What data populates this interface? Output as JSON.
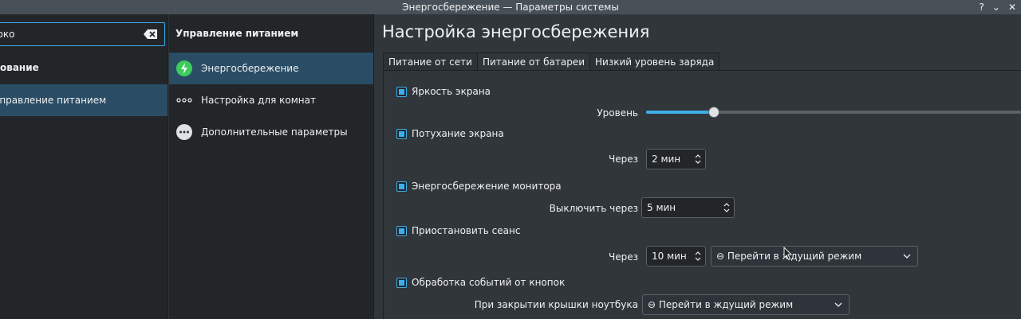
{
  "window": {
    "title": "Энергосбережение — Параметры системы",
    "help_glyph": "?",
    "minimize_glyph": "⌄",
    "close_glyph": "✕"
  },
  "sidebar": {
    "search_value": "ярко",
    "category_header": "ование",
    "category_item": "Управление питанием"
  },
  "subnav": {
    "header": "Управление питанием",
    "items": [
      {
        "label": "Энергосбережение",
        "icon": "power-saving-icon"
      },
      {
        "label": "Настройка для комнат",
        "icon": "activities-icon"
      },
      {
        "label": "Дополнительные параметры",
        "icon": "more-options-icon"
      }
    ]
  },
  "main": {
    "title": "Настройка энергосбережения",
    "tabs": [
      "Питание от сети",
      "Питание от батареи",
      "Низкий уровень заряда"
    ],
    "active_tab": 1,
    "brightness": {
      "label": "Яркость экрана",
      "checked": true,
      "level_label": "Уровень",
      "level_fraction": 0.18
    },
    "dim": {
      "label": "Потухание экрана",
      "checked": true,
      "after_label": "Через",
      "value": "2 мин"
    },
    "dpms": {
      "label": "Энергосбережение монитора",
      "checked": true,
      "after_label": "Выключить через",
      "value": "5 мин"
    },
    "suspend": {
      "label": "Приостановить сеанс",
      "checked": true,
      "after_label": "Через",
      "value": "10 мин",
      "action": "⊖ Перейти в ждущий режим"
    },
    "buttons": {
      "label": "Обработка событий от кнопок",
      "checked": true,
      "lid_label": "При закрытии крышки ноутбука",
      "lid_action": "⊖ Перейти в ждущий режим"
    }
  },
  "colors": {
    "accent": "#3daee9",
    "selection": "#2a4d65",
    "panel_dark": "#232629",
    "panel": "#31363b",
    "green_icon": "#3dcc5c"
  }
}
